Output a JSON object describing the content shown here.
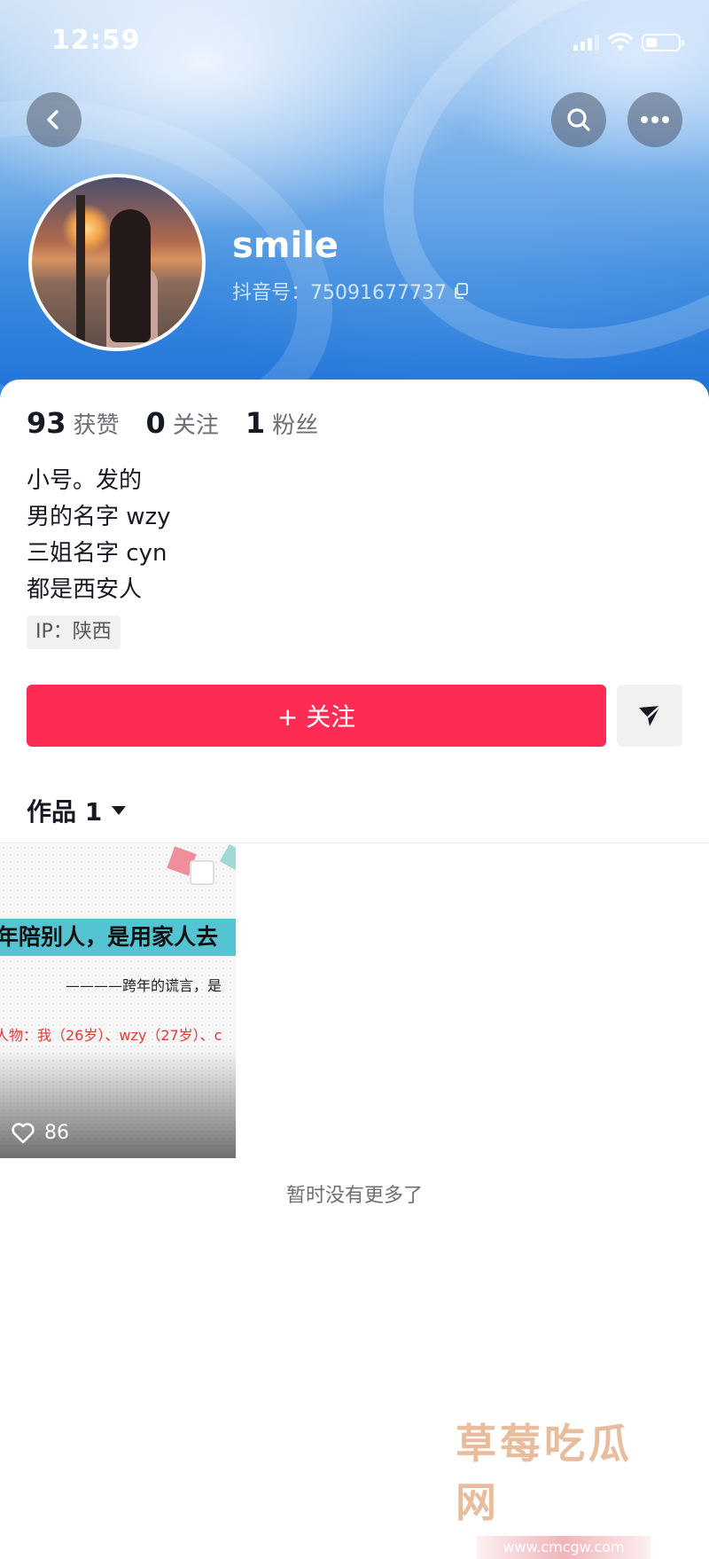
{
  "status_bar": {
    "time": "12:59"
  },
  "profile": {
    "username": "smile",
    "douyin_id": "抖音号：75091677737",
    "stats": [
      {
        "value": "93",
        "label": "获赞"
      },
      {
        "value": "0",
        "label": "关注"
      },
      {
        "value": "1",
        "label": "粉丝"
      }
    ],
    "bio": [
      "小号。发的",
      "男的名字 wzy",
      "三姐名字 cyn",
      "都是西安人"
    ],
    "ip": "IP：陕西"
  },
  "actions": {
    "follow_label": "+ 关注"
  },
  "tabs": {
    "works_label": "作品 1"
  },
  "video": {
    "banner_text": "年陪别人，是用家人去",
    "quote_text": "————跨年的谎言，是",
    "cast_text": "人物：我（26岁）、wzy（27岁）、c",
    "likes": "86"
  },
  "footer": {
    "no_more": "暂时没有更多了"
  },
  "watermark": {
    "title": "草莓吃瓜网",
    "url": "www.cmcgw.com"
  },
  "colors": {
    "accent": "#fe2c55",
    "header_blue": "#1f73da"
  },
  "icons": [
    "back-icon",
    "search-icon",
    "more-icon",
    "copy-icon",
    "share-icon",
    "dropdown-icon",
    "heart-icon"
  ]
}
